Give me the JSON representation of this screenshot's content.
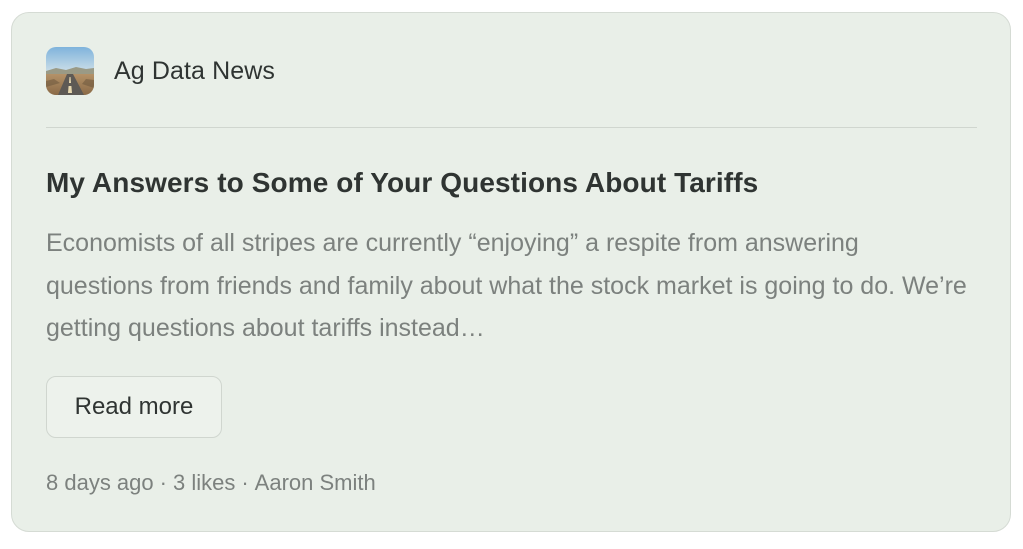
{
  "publication": {
    "name": "Ag Data News",
    "logo_icon": "landscape-logo"
  },
  "post": {
    "title": "My Answers to Some of Your Questions About Tariffs",
    "excerpt": "Economists of all stripes are currently “enjoying” a respite from answering questions from friends and family about what the stock market is going to do. We’re getting questions about tariffs instead…",
    "read_more_label": "Read more"
  },
  "meta": {
    "date": "8 days ago",
    "likes": "3 likes",
    "author": "Aaron Smith",
    "separator": "·"
  },
  "colors": {
    "card_background": "#e9efe8",
    "title_text": "#2f3432",
    "secondary_text": "#7c817e",
    "border": "#d0d6cf"
  }
}
